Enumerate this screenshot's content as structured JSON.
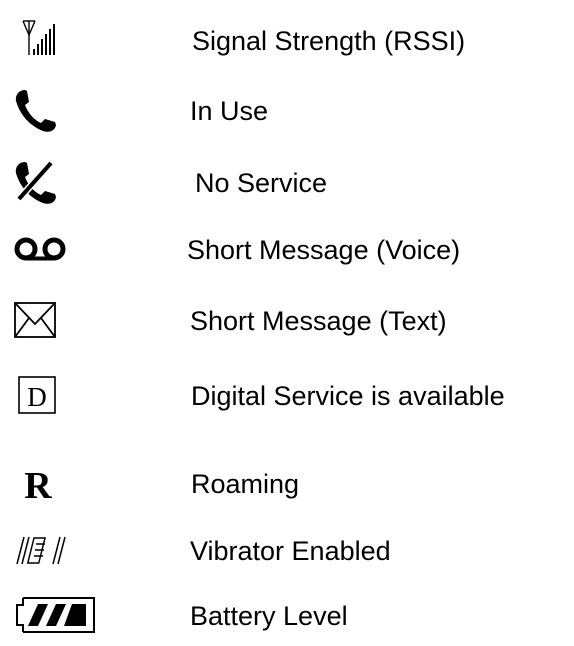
{
  "legend": {
    "items": [
      {
        "icon": "signal-strength-icon",
        "label": "Signal Strength (RSSI)"
      },
      {
        "icon": "phone-in-use-icon",
        "label": "In Use"
      },
      {
        "icon": "no-service-icon",
        "label": "No Service"
      },
      {
        "icon": "voicemail-icon",
        "label": "Short Message (Voice)"
      },
      {
        "icon": "envelope-icon",
        "label": "Short Message (Text)"
      },
      {
        "icon": "digital-service-icon",
        "label": "Digital Service is available",
        "icon_text": "D"
      },
      {
        "icon": "roaming-icon",
        "label": "Roaming",
        "icon_text": "R"
      },
      {
        "icon": "vibrator-icon",
        "label": "Vibrator Enabled"
      },
      {
        "icon": "battery-icon",
        "label": "Battery Level"
      }
    ]
  }
}
